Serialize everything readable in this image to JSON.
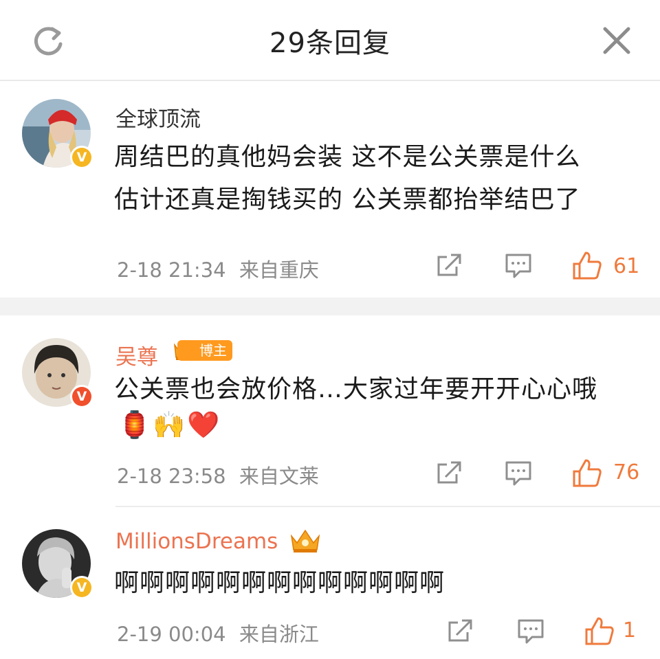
{
  "header": {
    "title": "29条回复",
    "refresh_icon": "refresh-icon",
    "close_icon": "close-icon"
  },
  "comments": [
    {
      "username": "全球顶流",
      "username_color": "#333333",
      "verified": "gold",
      "text_lines": [
        "周结巴的真他妈会装 这不是公关票是什么",
        "估计还真是掏钱买的 公关票都抬举结巴了"
      ],
      "time": "2-18 21:34",
      "location": "来自重庆",
      "likes": "61"
    },
    {
      "username": "吴尊",
      "username_color": "#eb7350",
      "verified": "red",
      "badge_label": "博主",
      "text_lines": [
        "公关票也会放价格…大家过年要开开心心哦"
      ],
      "emojis": [
        "🏮",
        "🙌",
        "❤️"
      ],
      "time": "2-18 23:58",
      "location": "来自文莱",
      "likes": "76"
    },
    {
      "username": "MillionsDreams",
      "username_color": "#eb7350",
      "verified": "gold",
      "text_lines": [
        "啊啊啊啊啊啊啊啊啊啊啊啊啊"
      ],
      "time": "2-19 00:04",
      "location": "来自浙江",
      "likes": "1"
    }
  ],
  "colors": {
    "accent": "#eb7350",
    "like": "#ef7a3c",
    "meta_text": "#8a8a8a",
    "gold_badge": "#f5b622",
    "red_badge": "#f0502c"
  }
}
